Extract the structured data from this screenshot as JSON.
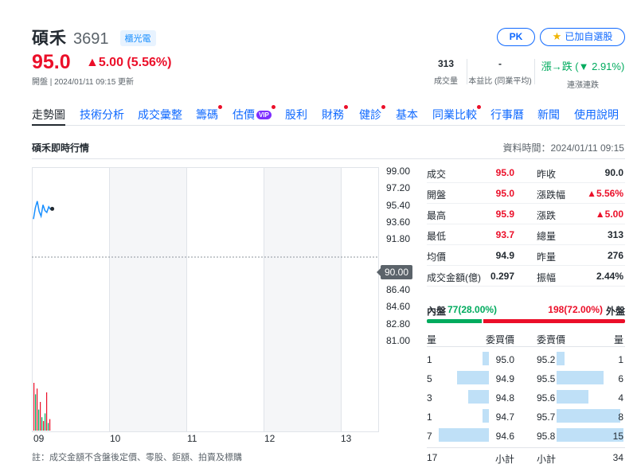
{
  "header": {
    "name": "碩禾",
    "code": "3691",
    "sector_tag": "櫃光電",
    "pk_label": "PK",
    "watchlist_label": "已加自選股",
    "price": "95.0",
    "change": "▲5.00 (5.56%)",
    "status": "開盤 | 2024/01/11 09:15 更新",
    "stats": [
      {
        "value": "313",
        "label": "成交量"
      },
      {
        "value": "-",
        "label": "本益比 (同業平均)"
      },
      {
        "value": "漲→跌 (▼ 2.91%)",
        "label": "連漲連跌"
      }
    ]
  },
  "tabs": [
    {
      "label": "走勢圖",
      "active": true,
      "dot": false,
      "vip": false
    },
    {
      "label": "技術分析",
      "dot": false
    },
    {
      "label": "成交彙整",
      "dot": false
    },
    {
      "label": "籌碼",
      "dot": true
    },
    {
      "label": "估價",
      "dot": true,
      "vip": true
    },
    {
      "label": "股利",
      "dot": false
    },
    {
      "label": "財務",
      "dot": true
    },
    {
      "label": "健診",
      "dot": true
    },
    {
      "label": "基本",
      "dot": false
    },
    {
      "label": "同業比較",
      "dot": true
    },
    {
      "label": "行事曆",
      "dot": false
    },
    {
      "label": "新聞",
      "dot": false
    },
    {
      "label": "使用說明",
      "dot": false
    }
  ],
  "section": {
    "title": "碩禾即時行情",
    "data_time": "資料時間：2024/01/11 09:15"
  },
  "chart_data": {
    "type": "line",
    "y_ticks": [
      "99.00",
      "97.20",
      "95.40",
      "93.60",
      "91.80",
      "90.00",
      "88.20",
      "86.40",
      "84.60",
      "82.80",
      "81.00"
    ],
    "ylim": [
      81.0,
      99.0
    ],
    "reference_price": "90.00",
    "x_ticks": [
      "09",
      "10",
      "11",
      "12",
      "13"
    ],
    "price_series": [
      94.0,
      95.2,
      95.9,
      94.8,
      94.3,
      95.5,
      94.9,
      94.7,
      95.3,
      95.0
    ],
    "volume_bars": [
      {
        "v": 50,
        "c": "#eb0f29"
      },
      {
        "v": 38,
        "c": "#00ab5e"
      },
      {
        "v": 44,
        "c": "#eb0f29"
      },
      {
        "v": 22,
        "c": "#00ab5e"
      },
      {
        "v": 30,
        "c": "#eb0f29"
      },
      {
        "v": 14,
        "c": "#00ab5e"
      },
      {
        "v": 10,
        "c": "#eb0f29"
      },
      {
        "v": 18,
        "c": "#00ab5e"
      },
      {
        "v": 40,
        "c": "#eb0f29"
      },
      {
        "v": 8,
        "c": "#00ab5e"
      },
      {
        "v": 12,
        "c": "#eb0f29"
      }
    ]
  },
  "footnote": "註：成交金額不含盤後定價、零股、鉅額、拍賣及標購",
  "quote": [
    {
      "l1": "成交",
      "v1": "95.0",
      "c1": "red",
      "l2": "昨收",
      "v2": "90.0",
      "c2": ""
    },
    {
      "l1": "開盤",
      "v1": "95.0",
      "c1": "red",
      "l2": "漲跌幅",
      "v2": "▲5.56%",
      "c2": "red"
    },
    {
      "l1": "最高",
      "v1": "95.9",
      "c1": "red",
      "l2": "漲跌",
      "v2": "▲5.00",
      "c2": "red"
    },
    {
      "l1": "最低",
      "v1": "93.7",
      "c1": "red",
      "l2": "總量",
      "v2": "313",
      "c2": ""
    },
    {
      "l1": "均價",
      "v1": "94.9",
      "c1": "",
      "l2": "昨量",
      "v2": "276",
      "c2": ""
    },
    {
      "l1": "成交金額(億)",
      "v1": "0.297",
      "c1": "",
      "l2": "振幅",
      "v2": "2.44%",
      "c2": ""
    }
  ],
  "inout": {
    "in_label": "內盤",
    "in_value": "77(28.00%)",
    "out_value": "198(72.00%)",
    "out_label": "外盤",
    "in_fraction": 0.28
  },
  "orderbook": {
    "headers": [
      "量",
      "委買價",
      "委賣價",
      "量"
    ],
    "rows": [
      {
        "bq": "1",
        "bp": "95.0",
        "ap": "95.2",
        "aq": "1",
        "bw": 0.12,
        "aw": 0.12
      },
      {
        "bq": "5",
        "bp": "94.9",
        "ap": "95.5",
        "aq": "6",
        "bw": 0.6,
        "aw": 0.7
      },
      {
        "bq": "3",
        "bp": "94.8",
        "ap": "95.6",
        "aq": "4",
        "bw": 0.4,
        "aw": 0.48
      },
      {
        "bq": "1",
        "bp": "94.7",
        "ap": "95.7",
        "aq": "8",
        "bw": 0.12,
        "aw": 0.95
      },
      {
        "bq": "7",
        "bp": "94.6",
        "ap": "95.8",
        "aq": "15",
        "bw": 0.95,
        "aw": 1.0
      }
    ],
    "footer": {
      "bq": "17",
      "bl": "小計",
      "al": "小計",
      "aq": "34"
    }
  }
}
